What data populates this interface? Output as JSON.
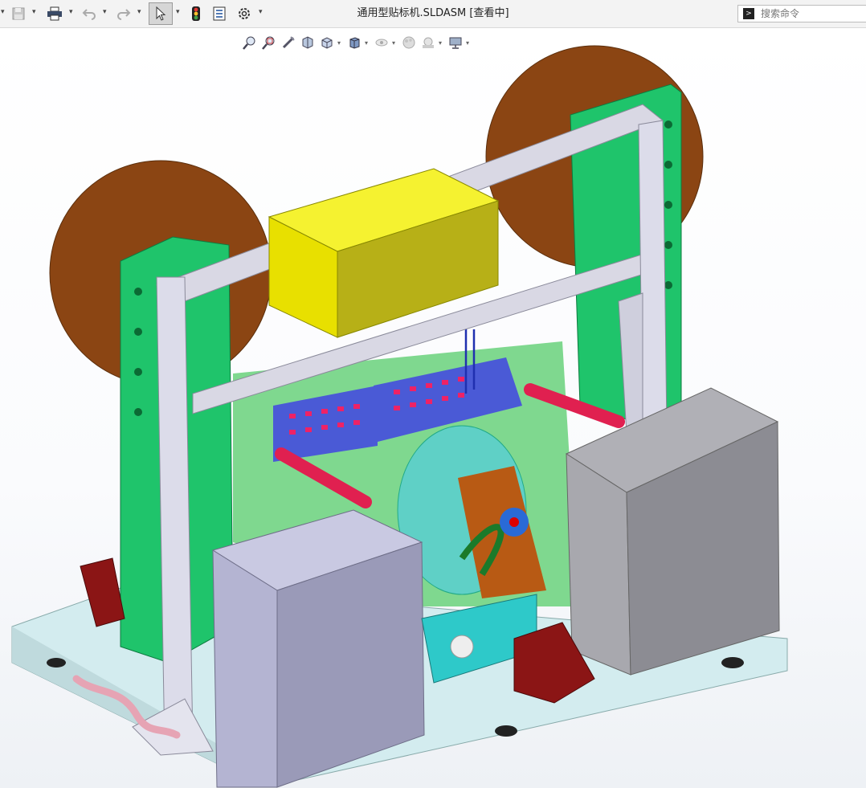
{
  "window": {
    "title": "通用型贴标机.SLDASM [查看中]"
  },
  "search": {
    "placeholder": "搜索命令"
  },
  "toolbar": {
    "icons": [
      "save-icon",
      "print-icon",
      "undo-icon",
      "redo-icon",
      "select-icon",
      "rebuild-icon",
      "file-properties-icon",
      "options-icon"
    ]
  },
  "heads_up_view": {
    "icons": [
      "zoom-to-fit-icon",
      "zoom-to-area-icon",
      "previous-view-icon",
      "section-view-icon",
      "view-orientation-icon",
      "display-style-icon",
      "hide-show-items-icon",
      "edit-appearance-icon",
      "apply-scene-icon",
      "view-settings-icon"
    ]
  },
  "model": {
    "name": "通用型贴标机"
  },
  "colors": {
    "toolbar_bg": "#f3f3f3",
    "frame": "#d9d8e4",
    "green_plate": "#1fc46b",
    "reel": "#8b4513",
    "yellow_box": "#e8e000",
    "gray_box": "#9c9ca3",
    "lavender_box": "#b4b4d2",
    "motor": "#8b1515"
  }
}
